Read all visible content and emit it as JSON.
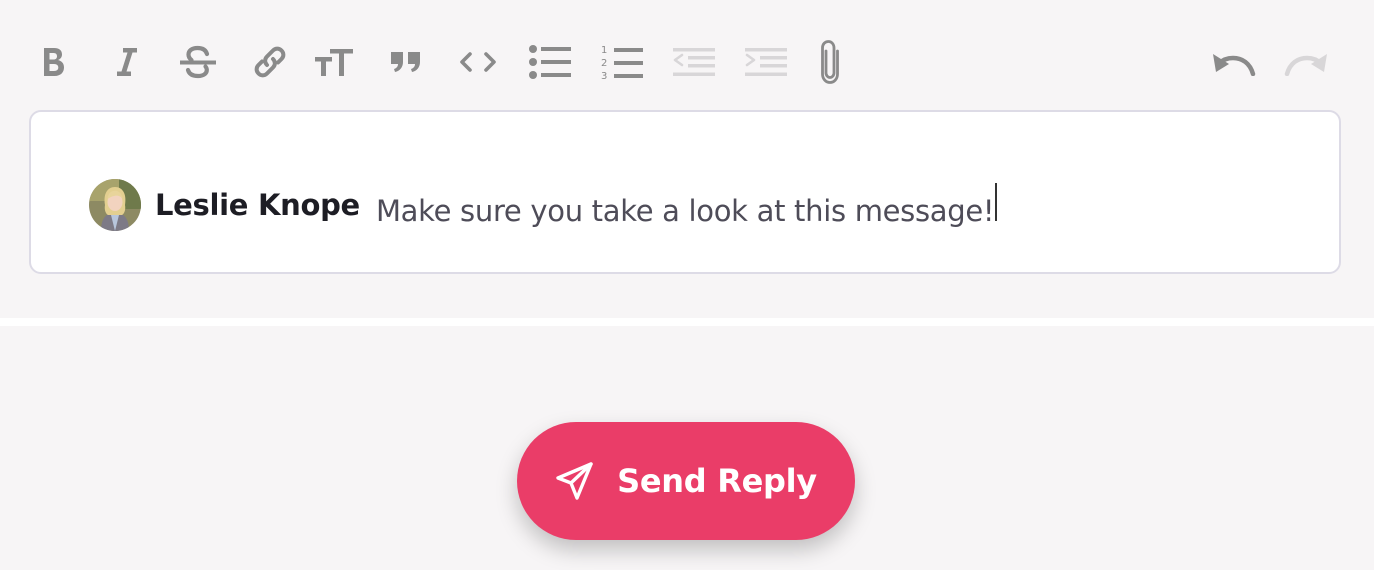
{
  "toolbar": {
    "buttons": [
      {
        "name": "bold-icon",
        "enabled": true
      },
      {
        "name": "italic-icon",
        "enabled": true
      },
      {
        "name": "strikethrough-icon",
        "enabled": true
      },
      {
        "name": "link-icon",
        "enabled": true
      },
      {
        "name": "heading-icon",
        "enabled": true
      },
      {
        "name": "quote-icon",
        "enabled": true
      },
      {
        "name": "code-icon",
        "enabled": true
      },
      {
        "name": "bullet-list-icon",
        "enabled": true
      },
      {
        "name": "numbered-list-icon",
        "enabled": true
      },
      {
        "name": "decrease-indent-icon",
        "enabled": false
      },
      {
        "name": "increase-indent-icon",
        "enabled": false
      },
      {
        "name": "attachment-icon",
        "enabled": true
      },
      {
        "name": "undo-icon",
        "enabled": true
      },
      {
        "name": "redo-icon",
        "enabled": false
      }
    ],
    "numbered_list_digits": [
      "1",
      "2",
      "3"
    ]
  },
  "editor": {
    "mention": {
      "name": "Leslie Knope",
      "avatar": "user-avatar"
    },
    "text": "Make sure you take a look at this message!"
  },
  "send_button": {
    "label": "Send Reply",
    "icon": "paper-plane-icon"
  },
  "colors": {
    "panel_background": "#f7f5f6",
    "toolbar_icon": "#8a8a8a",
    "toolbar_icon_disabled": "#d8d6d8",
    "editor_border": "#dddbe6",
    "accent": "#ea3d68",
    "mention_text": "#1d1d24",
    "body_text": "#4e4c58"
  }
}
